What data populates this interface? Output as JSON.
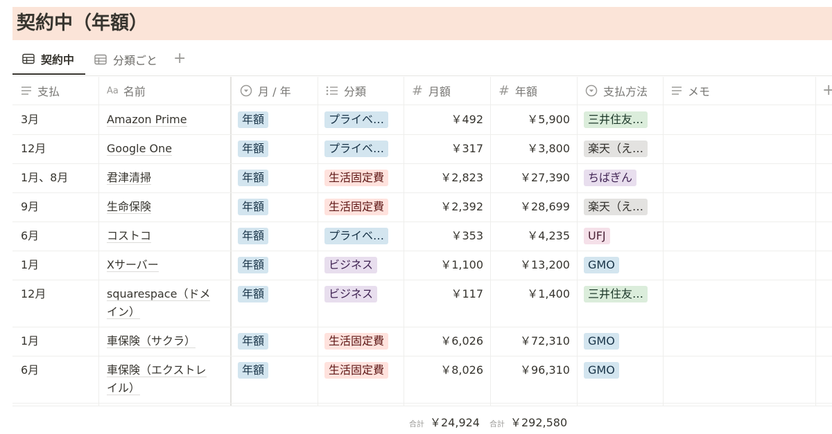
{
  "title": "契約中（年額）",
  "tabs": [
    {
      "label": "契約中",
      "active": true
    },
    {
      "label": "分類ごと",
      "active": false
    }
  ],
  "add_tab": "+",
  "columns": [
    {
      "key": "payment",
      "label": "支払",
      "icon": "lines-icon"
    },
    {
      "key": "name",
      "label": "名前",
      "icon": "aa-title-icon",
      "icon_text": "Aa"
    },
    {
      "key": "cycle",
      "label": "月 / 年",
      "icon": "select-icon"
    },
    {
      "key": "category",
      "label": "分類",
      "icon": "list-icon"
    },
    {
      "key": "monthly",
      "label": "月額",
      "icon": "number-icon",
      "icon_text": "#"
    },
    {
      "key": "yearly",
      "label": "年額",
      "icon": "number-icon",
      "icon_text": "#"
    },
    {
      "key": "method",
      "label": "支払方法",
      "icon": "select-icon"
    },
    {
      "key": "memo",
      "label": "メモ",
      "icon": "lines-icon"
    }
  ],
  "add_column": "+",
  "tag_colors": {
    "blue": {
      "bg": "#d3e5ef",
      "fg": "#183347"
    },
    "red": {
      "bg": "#ffe2dd",
      "fg": "#5d1715"
    },
    "purple": {
      "bg": "#e8deee",
      "fg": "#412454"
    },
    "green": {
      "bg": "#dbeddb",
      "fg": "#1c3829"
    },
    "gray": {
      "bg": "#e3e2e0",
      "fg": "#32302c"
    },
    "pink": {
      "bg": "#f5e0e9",
      "fg": "#4c2337"
    }
  },
  "rows": [
    {
      "payment": "3月",
      "name": [
        "Amazon Prime"
      ],
      "cycle": "年額",
      "category": "プライベ…",
      "category_color": "blue",
      "monthly": "￥492",
      "yearly": "￥5,900",
      "method": "三井住友…",
      "method_color": "green"
    },
    {
      "payment": "12月",
      "name": [
        "Google One"
      ],
      "cycle": "年額",
      "category": "プライベ…",
      "category_color": "blue",
      "monthly": "￥317",
      "yearly": "￥3,800",
      "method": "楽天（え…",
      "method_color": "gray"
    },
    {
      "payment": "1月、8月",
      "name": [
        "君津清掃"
      ],
      "cycle": "年額",
      "category": "生活固定費",
      "category_color": "red",
      "monthly": "￥2,823",
      "yearly": "￥27,390",
      "method": "ちばぎん",
      "method_color": "purple"
    },
    {
      "payment": "9月",
      "name": [
        "生命保険"
      ],
      "cycle": "年額",
      "category": "生活固定費",
      "category_color": "red",
      "monthly": "￥2,392",
      "yearly": "￥28,699",
      "method": "楽天（え…",
      "method_color": "gray"
    },
    {
      "payment": "6月",
      "name": [
        "コストコ"
      ],
      "cycle": "年額",
      "category": "プライベ…",
      "category_color": "blue",
      "monthly": "￥353",
      "yearly": "￥4,235",
      "method": "UFJ",
      "method_color": "pink"
    },
    {
      "payment": "1月",
      "name": [
        "Xサーバー"
      ],
      "cycle": "年額",
      "category": "ビジネス",
      "category_color": "purple",
      "monthly": "￥1,100",
      "yearly": "￥13,200",
      "method": "GMO",
      "method_color": "blue"
    },
    {
      "payment": "12月",
      "name": [
        "squarespace（ドメ",
        "イン）"
      ],
      "cycle": "年額",
      "category": "ビジネス",
      "category_color": "purple",
      "monthly": "￥117",
      "yearly": "￥1,400",
      "method": "三井住友…",
      "method_color": "green"
    },
    {
      "payment": "1月",
      "name": [
        "車保険（サクラ）"
      ],
      "cycle": "年額",
      "category": "生活固定費",
      "category_color": "red",
      "monthly": "￥6,026",
      "yearly": "￥72,310",
      "method": "GMO",
      "method_color": "blue"
    },
    {
      "payment": "6月",
      "name": [
        "車保険（エクストレ",
        "イル）"
      ],
      "cycle": "年額",
      "category": "生活固定費",
      "category_color": "red",
      "monthly": "￥8,026",
      "yearly": "￥96,310",
      "method": "GMO",
      "method_color": "blue"
    }
  ],
  "footer": {
    "monthly_label": "合計",
    "monthly_total": "￥24,924",
    "yearly_label": "合計",
    "yearly_total": "￥292,580"
  }
}
